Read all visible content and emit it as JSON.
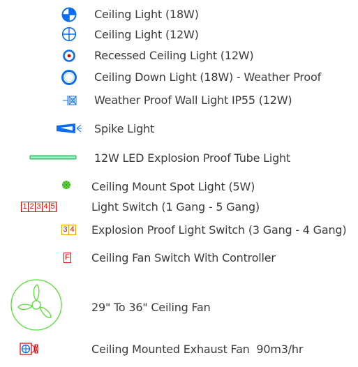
{
  "legend": {
    "items": [
      {
        "label": "Ceiling Light (18W)",
        "icon": "ceiling-light-18w-icon"
      },
      {
        "label": "Ceiling Light (12W)",
        "icon": "ceiling-light-12w-icon"
      },
      {
        "label": "Recessed Ceiling Light (12W)",
        "icon": "recessed-ceiling-light-icon"
      },
      {
        "label": "Ceiling Down Light (18W) - Weather Proof",
        "icon": "ceiling-down-light-icon"
      },
      {
        "label": "Weather Proof Wall Light IP55 (12W)",
        "icon": "wall-light-icon"
      },
      {
        "label": "Spike Light",
        "icon": "spike-light-icon"
      },
      {
        "label": "12W LED Explosion Proof Tube Light",
        "icon": "tube-light-icon"
      },
      {
        "label": "Ceiling Mount Spot Light (5W)",
        "icon": "spot-light-icon"
      },
      {
        "label": "Light Switch (1 Gang - 5 Gang)",
        "icon": "light-switch-icon",
        "symbol": [
          "1",
          "2",
          "3",
          "4",
          "5"
        ]
      },
      {
        "label": "Explosion Proof Light Switch (3 Gang - 4 Gang)",
        "icon": "explosion-proof-switch-icon",
        "symbol": [
          "3",
          "4"
        ]
      },
      {
        "label": "Ceiling Fan Switch With Controller",
        "icon": "fan-switch-icon",
        "symbol": [
          "F"
        ]
      },
      {
        "label": "29\" To 36\" Ceiling Fan",
        "icon": "ceiling-fan-icon"
      },
      {
        "label": "Ceiling Mounted Exhaust Fan  90m3/hr",
        "icon": "exhaust-fan-icon"
      }
    ]
  },
  "colors": {
    "blue": "#0a6cf0",
    "red": "#e00000",
    "orange": "#e8a000",
    "green": "#55dd33",
    "text": "#3a3a3a"
  }
}
